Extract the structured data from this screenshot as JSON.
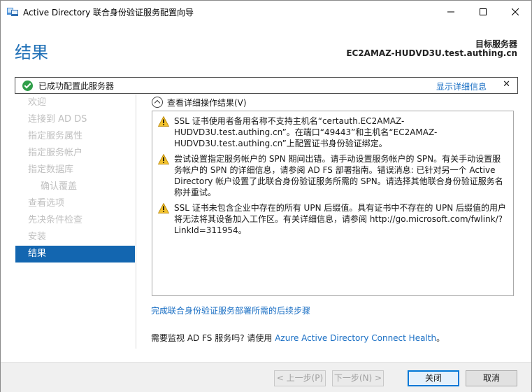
{
  "window": {
    "title": "Active Directory 联合身份验证服务配置向导",
    "controls": {
      "minimize": "—",
      "maximize": "☐",
      "close": "✕"
    }
  },
  "header": {
    "page_title": "结果",
    "target_label": "目标服务器",
    "target_value": "EC2AMAZ-HUDVD3U.test.authing.cn"
  },
  "notification": {
    "status": "success",
    "message": "已成功配置此服务器",
    "details_link": "显示详细信息",
    "dismiss": "✕"
  },
  "nav": {
    "items": [
      {
        "label": "欢迎",
        "state": "disabled"
      },
      {
        "label": "连接到 AD DS",
        "state": "disabled"
      },
      {
        "label": "指定服务属性",
        "state": "disabled"
      },
      {
        "label": "指定服务帐户",
        "state": "disabled"
      },
      {
        "label": "指定数据库",
        "state": "disabled"
      },
      {
        "label": "确认覆盖",
        "state": "disabled",
        "sub": true
      },
      {
        "label": "查看选项",
        "state": "disabled"
      },
      {
        "label": "先决条件检查",
        "state": "disabled"
      },
      {
        "label": "安装",
        "state": "disabled"
      },
      {
        "label": "结果",
        "state": "active"
      }
    ]
  },
  "results": {
    "expand_label": "查看详细操作结果(V)",
    "warnings": [
      "SSL 证书使用者备用名称不支持主机名“certauth.EC2AMAZ-HUDVD3U.test.authing.cn”。在端口“49443”和主机名“EC2AMAZ-HUDVD3U.test.authing.cn”上配置证书身份验证绑定。",
      "尝试设置指定服务帐户的 SPN 期间出错。请手动设置服务帐户的 SPN。有关手动设置服务帐户的 SPN 的详细信息，请参阅 AD FS 部署指南。错误消息: 已针对另一个 Active Directory 帐户设置了此联合身份验证服务所需的 SPN。请选择其他联合身份验证服务名称并重试。",
      "SSL 证书未包含企业中存在的所有 UPN 后缀值。具有证书中不存在的 UPN 后缀值的用户将无法将其设备加入工作区。有关详细信息，请参阅 http://go.microsoft.com/fwlink/?LinkId=311954。"
    ],
    "followup_link": "完成联合身份验证服务部署所需的后续步骤",
    "monitor_text": "需要监视 AD FS 服务吗? 请使用 ",
    "monitor_link": "Azure Active Directory Connect Health",
    "monitor_suffix": "。"
  },
  "footer": {
    "prev": "< 上一步(P)",
    "next": "下一步(N) >",
    "close": "关闭",
    "cancel": "取消"
  },
  "colors": {
    "accent": "#1366b0",
    "link": "#1a6fc4",
    "title": "#1e6fb6",
    "success": "#2e9e48",
    "warning": "#f2c22e"
  }
}
